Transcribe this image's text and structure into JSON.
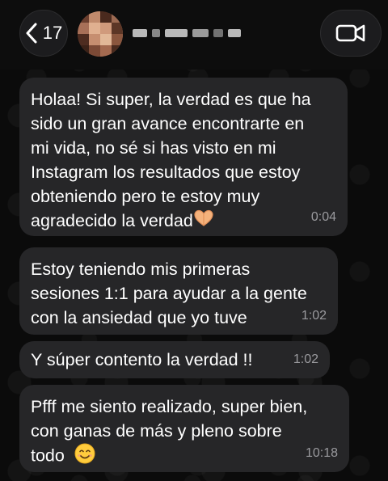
{
  "header": {
    "back_count": "17",
    "contact_name_visible": "",
    "icons": {
      "back": "chevron-left-icon",
      "video": "video-camera-icon"
    }
  },
  "messages": [
    {
      "text": "Holaa! Si super, la verdad es que ha\nsido un gran avance encontrarte en\nmi vida, no sé si has visto en mi\nInstagram los resultados que estoy\nobteniendo pero te estoy muy\nagradecido la verdad",
      "emoji": "heart-hands-emoji",
      "time": "0:04"
    },
    {
      "text": "Estoy teniendo mis primeras\nsesiones 1:1 para ayudar a la gente\ncon la ansiedad que yo tuve",
      "time": "1:02"
    },
    {
      "text": "Y súper contento la verdad !!",
      "time": "1:02"
    },
    {
      "text": "Pfff me siento realizado, super bien,\ncon ganas de más y pleno sobre\ntodo",
      "emoji": "smiling-face-emoji",
      "time": "10:18"
    }
  ],
  "colors": {
    "bubble": "#262628",
    "background": "#0b0b0b",
    "timestamp": "#9a9a9e"
  }
}
